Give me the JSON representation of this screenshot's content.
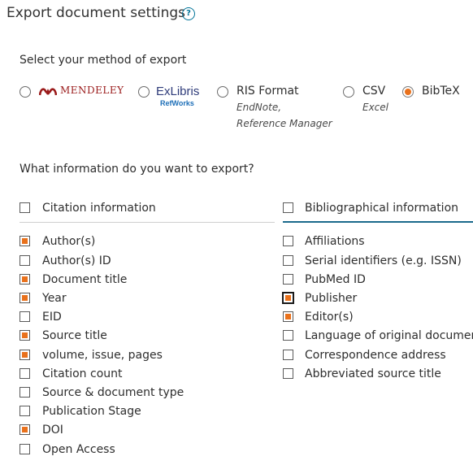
{
  "header": {
    "title": "Export document settings",
    "help_glyph": "?"
  },
  "method": {
    "label": "Select your method of export",
    "options": [
      {
        "id": "mendeley",
        "logo_text": "MENDELEY",
        "selected": false
      },
      {
        "id": "refworks",
        "logo_text": "ExLibris",
        "logo_sub": "RefWorks",
        "selected": false
      },
      {
        "id": "ris",
        "label": "RIS Format",
        "sub1": "EndNote,",
        "sub2": "Reference Manager",
        "selected": false
      },
      {
        "id": "csv",
        "label": "CSV",
        "sub1": "Excel",
        "selected": false
      },
      {
        "id": "bibtex",
        "label": "BibTeX",
        "selected": true
      }
    ]
  },
  "info": {
    "question": "What information do you want to export?",
    "left_group": {
      "label": "Citation information",
      "checked": false,
      "items": [
        {
          "label": "Author(s)",
          "checked": true
        },
        {
          "label": "Author(s) ID",
          "checked": false
        },
        {
          "label": "Document title",
          "checked": true
        },
        {
          "label": "Year",
          "checked": true
        },
        {
          "label": "EID",
          "checked": false
        },
        {
          "label": "Source title",
          "checked": true
        },
        {
          "label": "volume, issue, pages",
          "checked": true
        },
        {
          "label": "Citation count",
          "checked": false
        },
        {
          "label": "Source & document type",
          "checked": false
        },
        {
          "label": "Publication Stage",
          "checked": false
        },
        {
          "label": "DOI",
          "checked": true
        },
        {
          "label": "Open Access",
          "checked": false
        }
      ]
    },
    "right_group": {
      "label": "Bibliographical information",
      "checked": false,
      "items": [
        {
          "label": "Affiliations",
          "checked": false
        },
        {
          "label": "Serial identifiers (e.g. ISSN)",
          "checked": false
        },
        {
          "label": "PubMed ID",
          "checked": false
        },
        {
          "label": "Publisher",
          "checked": true,
          "focused": true
        },
        {
          "label": "Editor(s)",
          "checked": true
        },
        {
          "label": "Language of original document",
          "checked": false
        },
        {
          "label": "Correspondence address",
          "checked": false
        },
        {
          "label": "Abbreviated source title",
          "checked": false
        }
      ]
    }
  },
  "colors": {
    "accent": "#e9711c",
    "link": "#007398"
  }
}
